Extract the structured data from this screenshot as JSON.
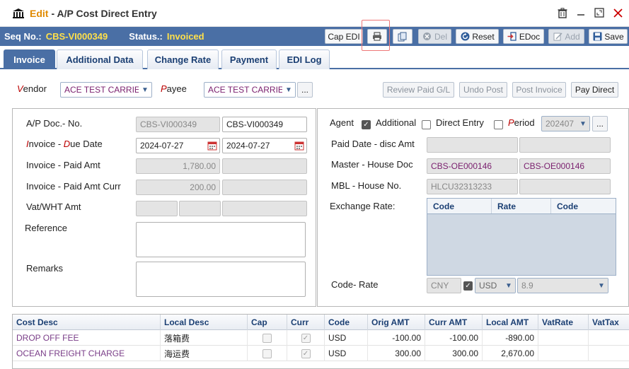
{
  "window": {
    "title_main": "Edit",
    "title_sub": "- A/P Cost Direct Entry"
  },
  "seq": {
    "label": "Seq No.:",
    "value": "CBS-VI000349",
    "status_label": "Status.:",
    "status_value": "Invoiced"
  },
  "toolbar": {
    "cap_edi": "Cap EDI",
    "del": "Del",
    "reset": "Reset",
    "edoc": "EDoc",
    "add": "Add",
    "save": "Save"
  },
  "tabs": [
    "Invoice",
    "Additional Data",
    "Change Rate",
    "Payment",
    "EDI Log"
  ],
  "header_row": {
    "vendor_label_first": "V",
    "vendor_label_rest": "endor",
    "vendor_value": "ACE TEST CARRIER",
    "payee_label_first": "P",
    "payee_label_rest": "ayee",
    "payee_value": "ACE TEST CARRIER",
    "more": "...",
    "review_paid": "Review Paid G/L",
    "undo_post": "Undo Post",
    "post_invoice": "Post Invoice",
    "pay_direct": "Pay Direct"
  },
  "left_panel": {
    "ap_doc_label": "A/P Doc.- No.",
    "ap_doc_value": "CBS-VI000349",
    "ap_no_value": "CBS-VI000349",
    "invoice_due_label_a": "I",
    "invoice_due_label_b": "nvoice - ",
    "invoice_due_label_c": "D",
    "invoice_due_label_d": "ue Date",
    "invoice_date": "2024-07-27",
    "due_date": "2024-07-27",
    "paid_amt_label": "Invoice - Paid Amt",
    "invoice_amt": "1,780.00",
    "paid_amt_curr_label": "Invoice - Paid Amt Curr",
    "invoice_amt_curr": "200.00",
    "vat_label": "Vat/WHT Amt",
    "reference_label": "Reference",
    "remarks_label": "Remarks"
  },
  "right_panel": {
    "agent_label": "Agent",
    "additional_label": "Additional",
    "direct_entry_label": "Direct Entry",
    "period_label_first": "P",
    "period_label_rest": "eriod",
    "period_value": "202407",
    "more": "...",
    "paid_date_label": "Paid Date - disc Amt",
    "master_house_label": "Master - House Doc",
    "master_doc": "CBS-OE000146",
    "house_doc": "CBS-OE000146",
    "mbl_house_label": "MBL - House No.",
    "mbl_no": "HLCU32313233",
    "exchange_rate_label": "Exchange Rate:",
    "rate_grid_cols": [
      "Code",
      "Rate",
      "Code"
    ],
    "code_rate_label": "Code- Rate",
    "code_value": "CNY",
    "curr_value": "USD",
    "rate_value": "8.9"
  },
  "grid": {
    "columns": [
      "Cost Desc",
      "Local Desc",
      "Cap",
      "Curr",
      "Code",
      "Orig AMT",
      "Curr AMT",
      "Local AMT",
      "VatRate",
      "VatTax"
    ],
    "rows": [
      {
        "cost_desc": "DROP OFF FEE",
        "local_desc": "落箱费",
        "code": "USD",
        "orig": "-100.00",
        "curr": "-100.00",
        "local": "-890.00"
      },
      {
        "cost_desc": "OCEAN FREIGHT CHARGE",
        "local_desc": "海运费",
        "code": "USD",
        "orig": "300.00",
        "curr": "300.00",
        "local": "2,670.00"
      }
    ]
  },
  "colors": {
    "accent": "#4a6fa5",
    "highlight": "#ffe04a",
    "title_orange": "#e08a00",
    "value_purple": "#7a1f6e"
  }
}
